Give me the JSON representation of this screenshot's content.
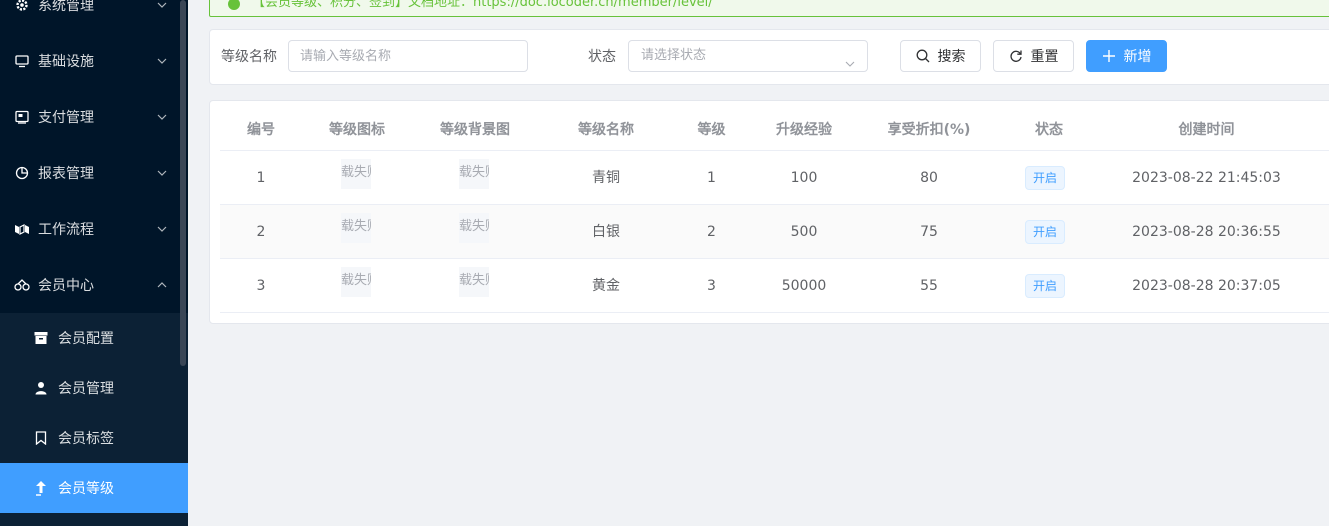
{
  "sidebar": {
    "items": [
      {
        "label": "系统管理",
        "icon": "gear-icon"
      },
      {
        "label": "基础设施",
        "icon": "monitor-icon"
      },
      {
        "label": "支付管理",
        "icon": "payment-icon"
      },
      {
        "label": "报表管理",
        "icon": "pie-chart-icon"
      },
      {
        "label": "工作流程",
        "icon": "workflow-icon"
      },
      {
        "label": "会员中心",
        "icon": "member-icon"
      }
    ],
    "submenu": [
      {
        "label": "会员配置",
        "icon": "box-icon"
      },
      {
        "label": "会员管理",
        "icon": "user-icon"
      },
      {
        "label": "会员标签",
        "icon": "bookmark-icon"
      },
      {
        "label": "会员等级",
        "icon": "arrow-up-icon",
        "active": true
      }
    ]
  },
  "alert": {
    "text": "【会员等级、积分、签到】文档地址：https://doc.iocoder.cn/member/level/"
  },
  "search": {
    "name_label": "等级名称",
    "name_placeholder": "请输入等级名称",
    "status_label": "状态",
    "status_placeholder": "请选择状态",
    "search_btn": "搜索",
    "reset_btn": "重置",
    "add_btn": "新增"
  },
  "table": {
    "headers": [
      "编号",
      "等级图标",
      "等级背景图",
      "等级名称",
      "等级",
      "升级经验",
      "享受折扣(%)",
      "状态",
      "创建时间"
    ],
    "img_alt": "载失败",
    "rows": [
      {
        "id": "1",
        "name": "青铜",
        "level": "1",
        "exp": "100",
        "discount": "80",
        "status": "开启",
        "created": "2023-08-22 21:45:03"
      },
      {
        "id": "2",
        "name": "白银",
        "level": "2",
        "exp": "500",
        "discount": "75",
        "status": "开启",
        "created": "2023-08-28 20:36:55"
      },
      {
        "id": "3",
        "name": "黄金",
        "level": "3",
        "exp": "50000",
        "discount": "55",
        "status": "开启",
        "created": "2023-08-28 20:37:05"
      }
    ]
  },
  "colors": {
    "sidebar_bg": "#001529",
    "primary": "#409eff",
    "success": "#67c23a"
  }
}
